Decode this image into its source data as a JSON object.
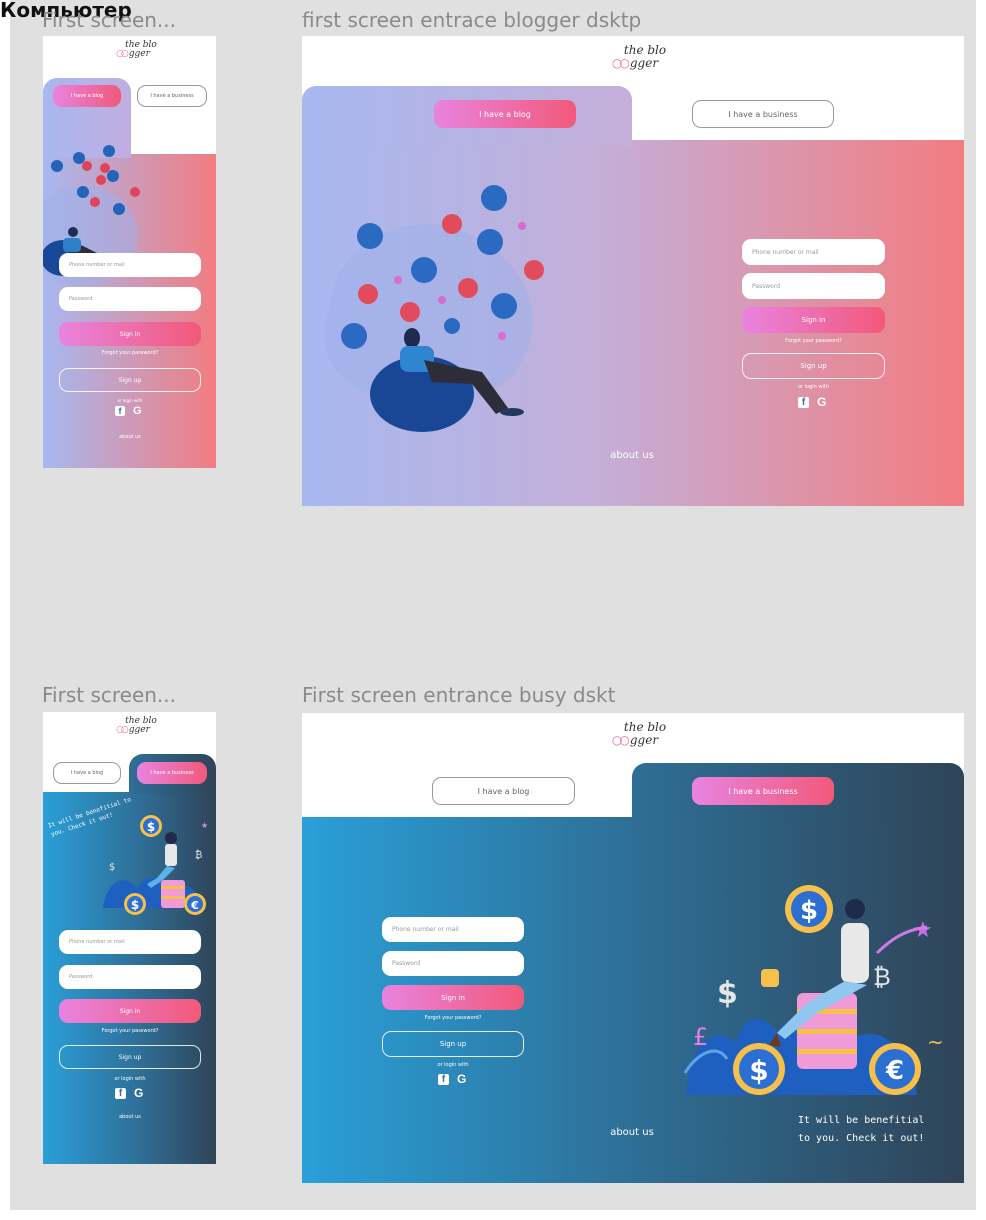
{
  "page_title": "Компьютер",
  "brand": {
    "logo_line1": "the blo",
    "logo_line2": "gger",
    "logo_mark": "○○"
  },
  "frames": {
    "mobile_blogger": {
      "label": "First screen...",
      "tab_blog": "I have a blog",
      "tab_business": "I have a business",
      "phone_placeholder": "Phone number or mail",
      "password_placeholder": "Password",
      "sign_in": "Sign in",
      "forgot": "Forgot your password?",
      "sign_up": "Sign up",
      "or_login": "or login with",
      "about": "about us"
    },
    "desktop_blogger": {
      "label": "first screen entrace blogger dsktp",
      "tab_blog": "I have a blog",
      "tab_business": "I have a business",
      "phone_placeholder": "Phone number or mail",
      "password_placeholder": "Password",
      "sign_in": "Sign in",
      "forgot": "Forgot your password?",
      "sign_up": "Sign up",
      "or_login": "or login with",
      "about": "about us"
    },
    "mobile_business": {
      "label": "First screen...",
      "tab_blog": "I have a blog",
      "tab_business": "I have a business",
      "tagline": "It will be benefitial to you. Check it out!",
      "phone_placeholder": "Phone number or mail",
      "password_placeholder": "Password",
      "sign_in": "Sign in",
      "forgot": "Forgot your password?",
      "sign_up": "Sign up",
      "or_login": "or login with",
      "about": "about us"
    },
    "desktop_business": {
      "label": "First screen entrance busy dskt",
      "tab_blog": "I have a blog",
      "tab_business": "I have a business",
      "phone_placeholder": "Phone number or mail",
      "password_placeholder": "Password",
      "sign_in": "Sign in",
      "forgot": "Forgot your password?",
      "sign_up": "Sign up",
      "or_login": "or login with",
      "about": "about us",
      "tagline_line1": "It will be benefitial",
      "tagline_line2": "to you. Check it out!"
    }
  },
  "colors": {
    "blogger_gradient_start": "#a7b8f0",
    "blogger_gradient_end": "#f27c80",
    "business_gradient_start": "#2a9fd8",
    "business_gradient_end": "#2f4458",
    "button_pink": "#e883df",
    "button_red": "#f2597a",
    "canvas": "#e0e0e0"
  },
  "icons": [
    "thumbs-up-icon",
    "heart-icon",
    "facebook-icon",
    "google-icon",
    "dollar-coin-icon",
    "euro-coin-icon",
    "star-icon"
  ]
}
